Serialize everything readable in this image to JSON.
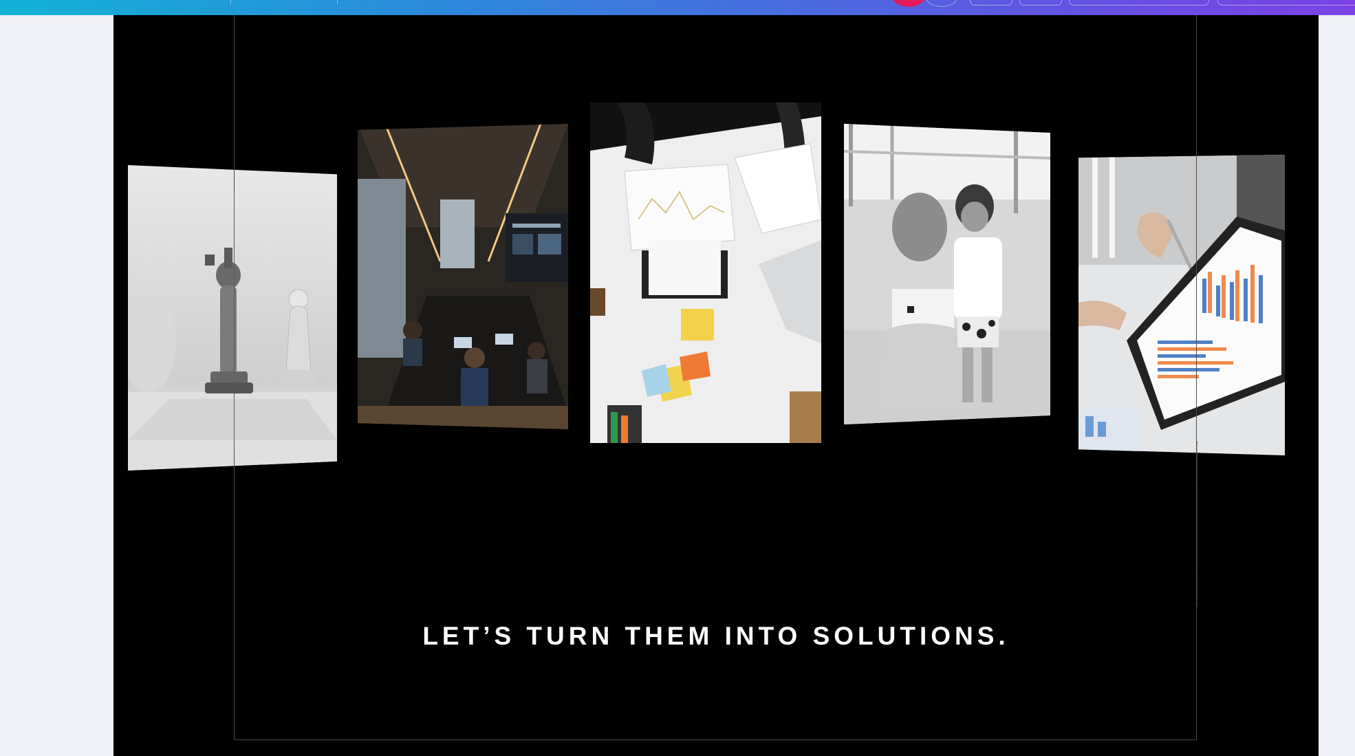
{
  "headline": "LET’S TURN THEM INTO SOLUTIONS.",
  "colors": {
    "toolbar_start": "#12b2d6",
    "toolbar_end": "#7c42e6",
    "canvas_bg": "#000000",
    "page_bg": "#eef0f5",
    "headline": "#ffffff"
  },
  "gallery": [
    {
      "subject": "chess-pieces-photo"
    },
    {
      "subject": "office-meeting-room-photo"
    },
    {
      "subject": "desk-charts-sticky-notes-photo"
    },
    {
      "subject": "mother-and-daughter-photo"
    },
    {
      "subject": "clipboard-bar-chart-photo"
    }
  ]
}
